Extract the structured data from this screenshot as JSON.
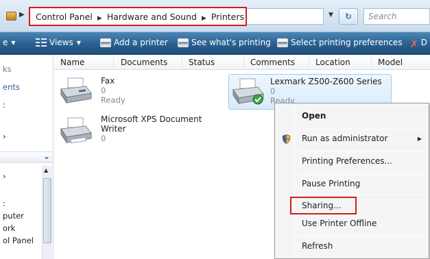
{
  "address_bar": {
    "breadcrumbs": [
      "Control Panel",
      "Hardware and Sound",
      "Printers"
    ],
    "search_placeholder": "Search"
  },
  "toolbar": {
    "left_fragment": "e",
    "views_label": "Views",
    "add_printer_label": "Add a printer",
    "see_printing_label": "See what's printing",
    "select_prefs_label": "Select printing preferences",
    "delete_fragment": "D"
  },
  "nav_pane": {
    "items": [
      "ks",
      "ents",
      ":",
      "",
      "",
      "",
      ":",
      "puter",
      "ork",
      "ol Panel",
      ""
    ]
  },
  "columns": [
    "Name",
    "Documents",
    "Status",
    "Comments",
    "Location",
    "Model"
  ],
  "printers": [
    {
      "name": "Fax",
      "jobs": "0",
      "status": "Ready"
    },
    {
      "name": "Microsoft XPS Document Writer",
      "name_line1": "Microsoft XPS Document",
      "name_line2": "Writer",
      "jobs": "0"
    },
    {
      "name": "Lexmark Z500-Z600 Series",
      "jobs": "0",
      "status": "Ready",
      "is_default": true
    }
  ],
  "context_menu": {
    "items": [
      {
        "label": "Open",
        "bold": true
      },
      {
        "label": "Run as administrator",
        "submenu": true,
        "icon": "uac-shield-icon"
      },
      {
        "label": "Printing Preferences..."
      },
      {
        "label": "Pause Printing"
      },
      {
        "label": "Sharing...",
        "highlighted_box": true
      },
      {
        "label": "Use Printer Offline"
      },
      {
        "label": "Refresh"
      }
    ]
  },
  "colors": {
    "highlight_box": "#d21c1c",
    "toolbar_bg": "#2a5f8f",
    "selection_bg": "#d8ebfa"
  }
}
